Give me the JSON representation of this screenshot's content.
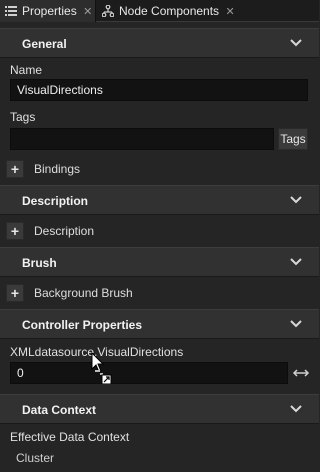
{
  "tabs": [
    {
      "label": "Properties",
      "icon": "list-icon",
      "active": true
    },
    {
      "label": "Node Components",
      "icon": "node-components-icon",
      "active": false
    }
  ],
  "sections": {
    "general": {
      "title": "General"
    },
    "description": {
      "title": "Description"
    },
    "brush": {
      "title": "Brush"
    },
    "controller_properties": {
      "title": "Controller Properties"
    },
    "data_context": {
      "title": "Data Context"
    }
  },
  "general": {
    "name_label": "Name",
    "name_value": "VisualDirections",
    "tags_label": "Tags",
    "tags_value": "",
    "tags_button": "Tags",
    "bindings_label": "Bindings"
  },
  "description": {
    "add_label": "Description"
  },
  "brush": {
    "add_label": "Background Brush"
  },
  "controller_properties": {
    "field_label": "XMLdatasource.VisualDirections",
    "field_value": "0"
  },
  "data_context": {
    "effective_label": "Effective Data Context",
    "effective_value": "Cluster"
  },
  "colors": {
    "background": "#252526",
    "section_header": "#313131",
    "input_background": "#121212",
    "text": "#e6e6e6"
  }
}
